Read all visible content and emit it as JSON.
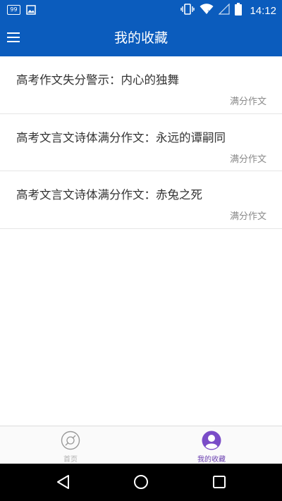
{
  "status_bar": {
    "notification_count": "99",
    "time": "14:12",
    "icons": [
      "notification-badge-icon",
      "image-icon",
      "vibrate-icon",
      "wifi-icon",
      "signal-icon",
      "battery-icon"
    ]
  },
  "app_bar": {
    "title": "我的收藏",
    "menu_icon": "menu-icon"
  },
  "favorites": [
    {
      "title": "高考作文失分警示：内心的独舞",
      "tag": "满分作文"
    },
    {
      "title": "高考文言文诗体满分作文：永远的谭嗣同",
      "tag": "满分作文"
    },
    {
      "title": "高考文言文诗体满分作文：赤兔之死",
      "tag": "满分作文"
    }
  ],
  "bottom_nav": {
    "tabs": [
      {
        "label": "首页",
        "icon": "compass-icon",
        "active": false
      },
      {
        "label": "我的收藏",
        "icon": "user-icon",
        "active": true
      }
    ]
  },
  "colors": {
    "primary": "#0b5cbd",
    "active_tab": "#6a3fb0",
    "inactive_tab": "#b0b0b0"
  }
}
